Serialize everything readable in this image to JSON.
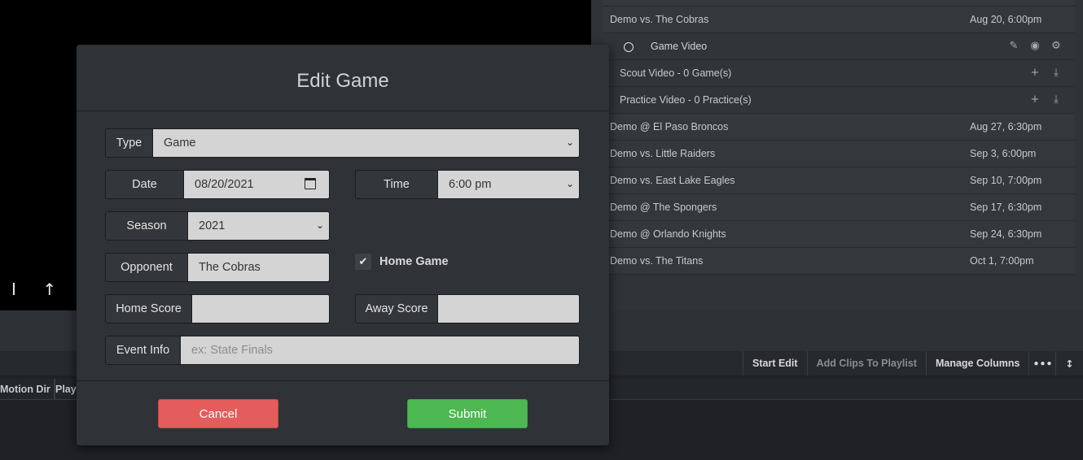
{
  "video": {
    "arrows": [
      "I",
      "↑",
      "↑"
    ]
  },
  "schedule": {
    "rows": [
      {
        "name": "Demo vs. The Cobras",
        "date": "Aug 20, 6:00pm"
      },
      {
        "name": "Demo @ El Paso Broncos",
        "date": "Aug 27, 6:30pm"
      },
      {
        "name": "Demo vs. Little Raiders",
        "date": "Sep 3, 6:00pm"
      },
      {
        "name": "Demo vs. East Lake Eagles",
        "date": "Sep 10, 7:00pm"
      },
      {
        "name": "Demo @ The Spongers",
        "date": "Sep 17, 6:30pm"
      },
      {
        "name": "Demo @ Orlando Knights",
        "date": "Sep 24, 6:30pm"
      },
      {
        "name": "Demo vs. The Titans",
        "date": "Oct 1, 7:00pm"
      }
    ],
    "sub": {
      "game_video": "Game Video",
      "scout_video": "Scout Video - 0 Game(s)",
      "practice_video": "Practice Video - 0 Practice(s)"
    },
    "icons": {
      "pencil": "✎",
      "eye": "◉",
      "gear": "⚙",
      "plus": "+",
      "download": "⤓"
    }
  },
  "toolbar": {
    "start_edit": "Start Edit",
    "add_clips": "Add Clips To Playlist",
    "manage_columns": "Manage Columns",
    "more": "•••",
    "resize": "↕"
  },
  "table": {
    "headers": [
      "Motion Dir",
      "Play"
    ]
  },
  "modal": {
    "title": "Edit Game",
    "type_label": "Type",
    "type_value": "Game",
    "date_label": "Date",
    "date_value": "08/20/2021",
    "time_label": "Time",
    "time_value": "6:00 pm",
    "season_label": "Season",
    "season_value": "2021",
    "opponent_label": "Opponent",
    "opponent_value": "The Cobras",
    "home_game_label": "Home Game",
    "home_game_checked": true,
    "home_score_label": "Home Score",
    "home_score_value": "",
    "away_score_label": "Away Score",
    "away_score_value": "",
    "event_info_label": "Event Info",
    "event_info_placeholder": "ex: State Finals",
    "cancel_label": "Cancel",
    "submit_label": "Submit",
    "chevron": "⌄",
    "check_glyph": "✔"
  },
  "colors": {
    "cancel": "#e45c5c",
    "submit": "#4db851"
  }
}
